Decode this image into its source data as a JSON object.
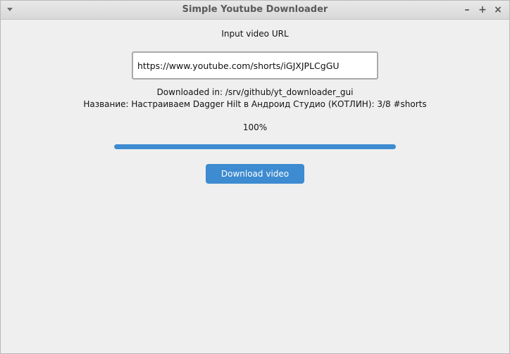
{
  "window": {
    "title": "Simple Youtube Downloader",
    "buttons": {
      "minimize": "–",
      "maximize": "+",
      "close": "×"
    }
  },
  "form": {
    "url_label": "Input video URL",
    "url_value": "https://www.youtube.com/shorts/iGJXJPLCgGU"
  },
  "status": {
    "downloaded_in": "Downloaded in: /srv/github/yt_downloader_gui",
    "video_title": "Название: Настраиваем Dagger Hilt в Андроид Студио (КОТЛИН): 3/8 #shorts",
    "percent_text": "100%",
    "progress_fraction": 1.0
  },
  "actions": {
    "download_label": "Download video"
  },
  "colors": {
    "accent": "#3d8bd0",
    "background": "#efefef"
  }
}
